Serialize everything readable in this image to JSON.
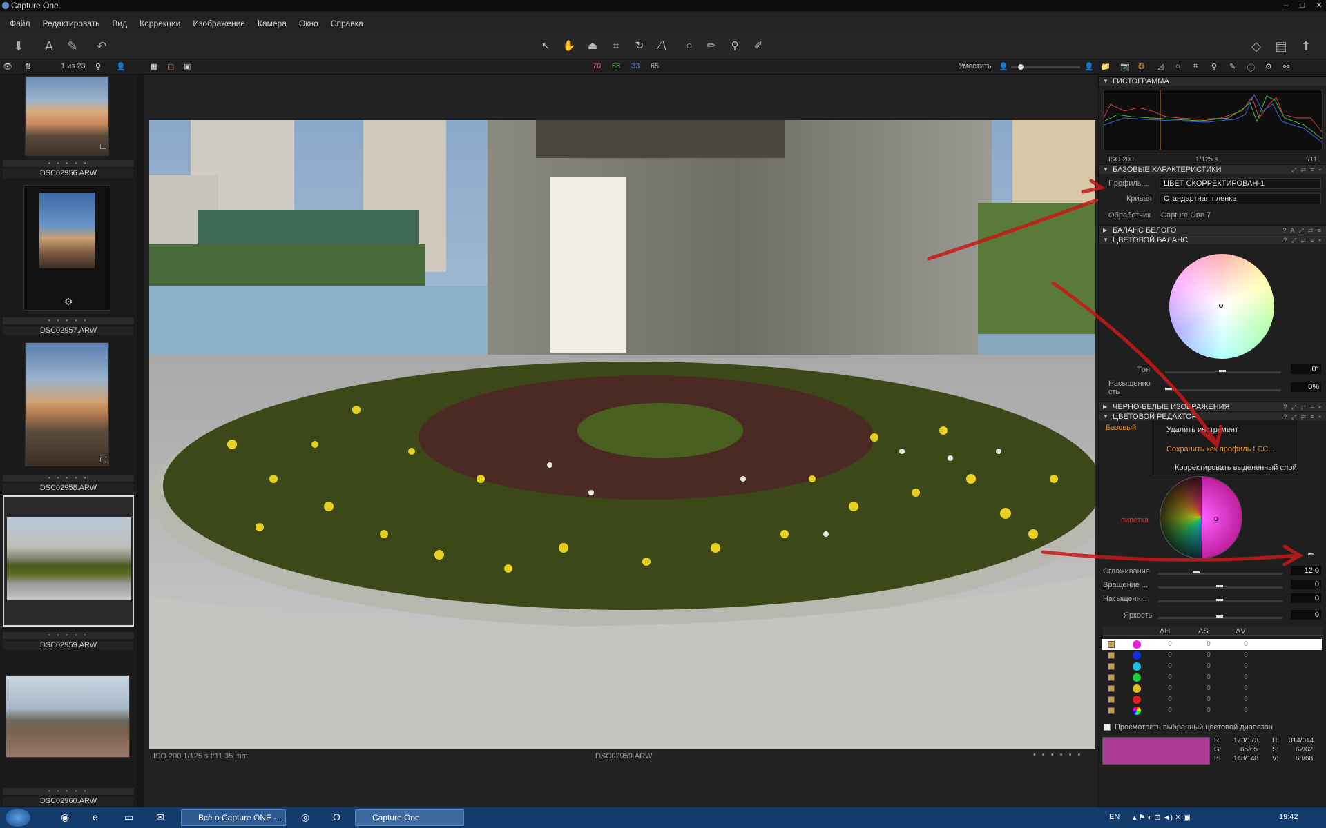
{
  "window": {
    "title": "Capture One",
    "controls": [
      "–",
      "□",
      "✕"
    ]
  },
  "menu": [
    "Файл",
    "Редактировать",
    "Вид",
    "Коррекции",
    "Изображение",
    "Камера",
    "Окно",
    "Справка"
  ],
  "viewerbar": {
    "count": "1 из 23",
    "levels": [
      "70",
      "68",
      "33",
      "65"
    ],
    "fit_label": "Уместить"
  },
  "browser": {
    "thumbnails": [
      {
        "name": "DSC02956.ARW",
        "dots": "• • • • •"
      },
      {
        "name": "DSC02957.ARW",
        "dots": "• • • • •"
      },
      {
        "name": "DSC02958.ARW",
        "dots": "• • • • •"
      },
      {
        "name": "DSC02959.ARW",
        "dots": "• • • • •"
      },
      {
        "name": "DSC02960.ARW",
        "dots": "• • • • •"
      }
    ]
  },
  "viewer": {
    "exif": "ISO 200   1/125 s   f/11   35 mm",
    "filename": "DSC02959.ARW",
    "nav_dots": "• • • • • •"
  },
  "histogram": {
    "title": "ГИСТОГРАММА",
    "iso": "ISO 200",
    "shutter": "1/125 s",
    "aperture": "f/11"
  },
  "basic": {
    "title": "БАЗОВЫЕ ХАРАКТЕРИСТИКИ",
    "profile_label": "Профиль ...",
    "profile_value": "ЦВЕТ СКОРРЕКТИРОВАН-1",
    "curve_label": "Кривая",
    "curve_value": "Стандартная пленка",
    "processor_label": "Обработчик",
    "processor_value": "Capture One 7"
  },
  "white_balance": {
    "title": "БАЛАНС БЕЛОГО"
  },
  "color_balance": {
    "title": "ЦВЕТОВОЙ БАЛАНС",
    "tone_label": "Тон",
    "tone_value": "0°",
    "sat_label": "Насыщенно сть",
    "sat_value": "0%"
  },
  "bw": {
    "title": "ЧЕРНО-БЕЛЫЕ ИЗОБРАЖЕНИЯ"
  },
  "color_editor": {
    "title": "ЦВЕТОВОЙ РЕДАКТОР",
    "tab_basic": "Базовый",
    "annotation": "пипетка",
    "smoothing_label": "Сглаживание",
    "smoothing_value": "12,0",
    "rotation_label": "Вращение ...",
    "rotation_value": "0",
    "saturation_label": "Насыщенн...",
    "saturation_value": "0",
    "brightness_label": "Яркость",
    "brightness_value": "0",
    "col_dh": "ΔH",
    "col_ds": "ΔS",
    "col_dv": "ΔV",
    "rows": [
      {
        "color": "#e020d0",
        "dh": "0",
        "ds": "0",
        "dv": "0"
      },
      {
        "color": "#1030e0",
        "dh": "0",
        "ds": "0",
        "dv": "0"
      },
      {
        "color": "#20c0e0",
        "dh": "0",
        "ds": "0",
        "dv": "0"
      },
      {
        "color": "#20d040",
        "dh": "0",
        "ds": "0",
        "dv": "0"
      },
      {
        "color": "#e0c020",
        "dh": "0",
        "ds": "0",
        "dv": "0"
      },
      {
        "color": "#e02020",
        "dh": "0",
        "ds": "0",
        "dv": "0"
      },
      {
        "color": "#d0d0d0",
        "dh": "0",
        "ds": "0",
        "dv": "0"
      }
    ],
    "view_range_label": "Просмотреть выбранный цветовой диапазон",
    "readout": {
      "r": "R:",
      "r_val": "173/173",
      "g": "G:",
      "g_val": "65/65",
      "b": "B:",
      "b_val": "148/148",
      "h": "H:",
      "h_val": "314/314",
      "s": "S:",
      "s_val": "62/62",
      "v": "V:",
      "v_val": "68/68"
    },
    "swatch_color": "#ad3c96"
  },
  "context_menu": {
    "delete": "Удалить инструмент",
    "save_lcc": "Сохранить как профиль LCC...",
    "correct_layer": "Корректировать выделенный слой"
  },
  "taskbar": {
    "task1": "Всё о Capture ONE -...",
    "task2": "Capture One",
    "lang": "EN",
    "clock": "19:42"
  }
}
